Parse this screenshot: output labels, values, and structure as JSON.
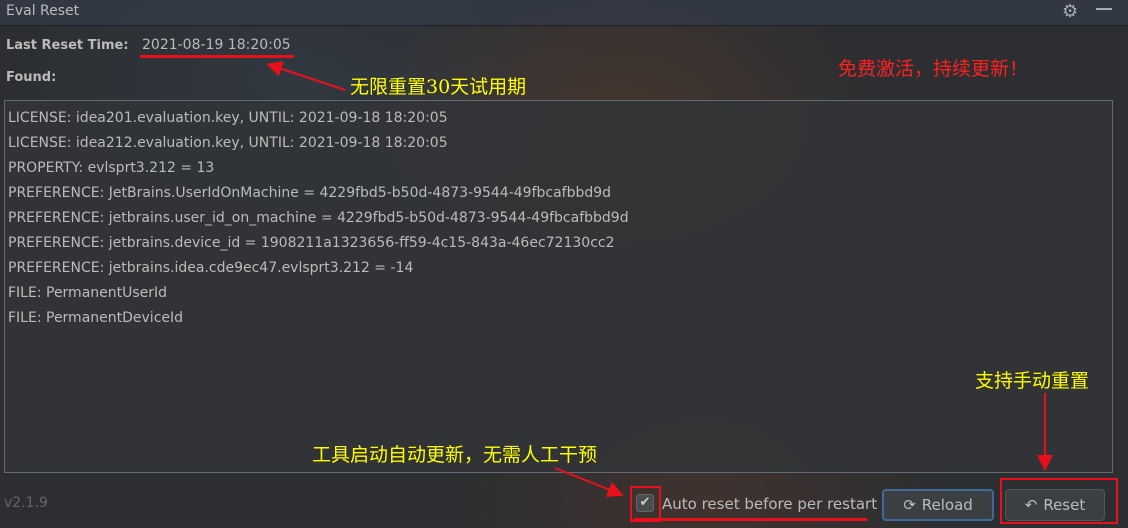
{
  "window": {
    "title": "Eval Reset"
  },
  "labels": {
    "last_reset": "Last Reset Time:",
    "found": "Found:"
  },
  "last_reset_time": "2021-08-19 18:20:05",
  "found_items": [
    "LICENSE: idea201.evaluation.key, UNTIL: 2021-09-18 18:20:05",
    "LICENSE: idea212.evaluation.key, UNTIL: 2021-09-18 18:20:05",
    "PROPERTY: evlsprt3.212 = 13",
    "PREFERENCE: JetBrains.UserIdOnMachine = 4229fbd5-b50d-4873-9544-49fbcafbbd9d",
    "PREFERENCE: jetbrains.user_id_on_machine = 4229fbd5-b50d-4873-9544-49fbcafbbd9d",
    "PREFERENCE: jetbrains.device_id = 1908211a1323656-ff59-4c15-843a-46ec72130cc2",
    "PREFERENCE: jetbrains.idea.cde9ec47.evlsprt3.212 = -14",
    "FILE: PermanentUserId",
    "FILE: PermanentDeviceId"
  ],
  "footer": {
    "version": "v2.1.9",
    "auto_reset_label": "Auto reset before per restart",
    "auto_reset_checked": true,
    "reload_label": "Reload",
    "reset_label": "Reset"
  },
  "annotations": {
    "unlimited": "无限重置30天试用期",
    "free": "免费激活，持续更新！",
    "manual": "支持手动重置",
    "auto": "工具启动自动更新，无需人工干预"
  },
  "colors": {
    "annotation_red": "#e8111b",
    "annotation_yellow": "#ffff00"
  }
}
